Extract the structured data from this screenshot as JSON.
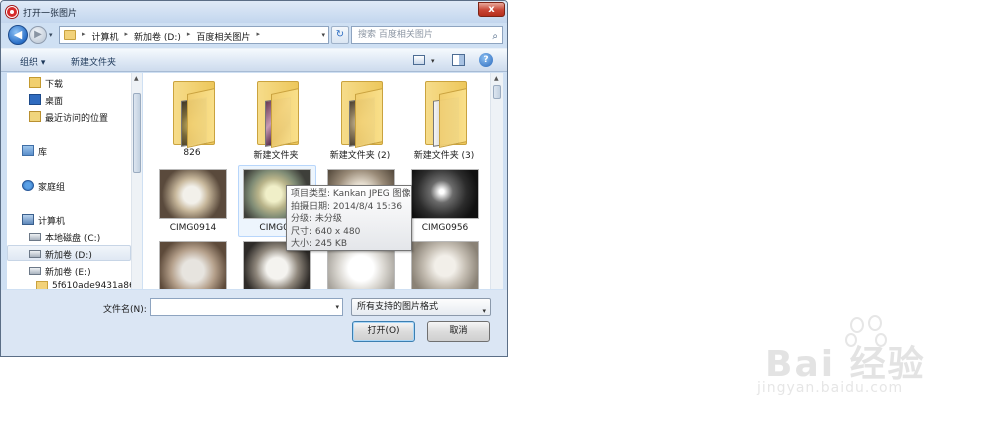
{
  "window": {
    "title": "打开一张图片",
    "close_glyph": "x"
  },
  "nav": {
    "back_glyph": "◀",
    "forward_glyph": "▶",
    "drop_glyph": "▾",
    "breadcrumbs": [
      "计算机",
      "新加卷 (D:)",
      "百度相关图片"
    ],
    "crumb_sep": "▸",
    "refresh_glyph": "↻",
    "search_placeholder": "搜索 百度相关图片",
    "search_glyph": "⌕"
  },
  "commands": {
    "organize": "组织 ▾",
    "new_folder": "新建文件夹",
    "help_glyph": "?"
  },
  "sidebar": {
    "items": [
      {
        "label": "下载",
        "icon": "download-folder-icon"
      },
      {
        "label": "桌面",
        "icon": "desktop-icon"
      },
      {
        "label": "最近访问的位置",
        "icon": "recent-places-icon"
      },
      {
        "label": "库",
        "icon": "library-icon"
      },
      {
        "label": "家庭组",
        "icon": "homegroup-icon"
      },
      {
        "label": "计算机",
        "icon": "computer-icon"
      },
      {
        "label": "本地磁盘 (C:)",
        "icon": "drive-icon"
      },
      {
        "label": "新加卷 (D:)",
        "icon": "drive-icon",
        "selected": true
      },
      {
        "label": "新加卷 (E:)",
        "icon": "drive-icon"
      },
      {
        "label": "5f610ade9431a86",
        "icon": "folder-icon"
      }
    ]
  },
  "files": {
    "folders": [
      "826",
      "新建文件夹",
      "新建文件夹 (2)",
      "新建文件夹 (3)"
    ],
    "photos": [
      "CIMG0914",
      "CIMG09",
      "",
      "CIMG0956"
    ]
  },
  "tooltip": {
    "lines": [
      "项目类型: Kankan JPEG 图像",
      "拍摄日期: 2014/8/4 15:36",
      "分级: 未分级",
      "尺寸: 640 x 480",
      "大小: 245 KB"
    ]
  },
  "bottom": {
    "filename_label": "文件名(N):",
    "filename_value": "",
    "file_type": "所有支持的图片格式",
    "open_label": "打开(O)",
    "cancel_label": "取消"
  },
  "watermark": {
    "text": "Bai 经验",
    "url": "jingyan.baidu.com"
  },
  "colors": {
    "window_frame": "#cfe0f3",
    "close_red": "#c84433",
    "accent_blue": "#2a6fc7"
  }
}
